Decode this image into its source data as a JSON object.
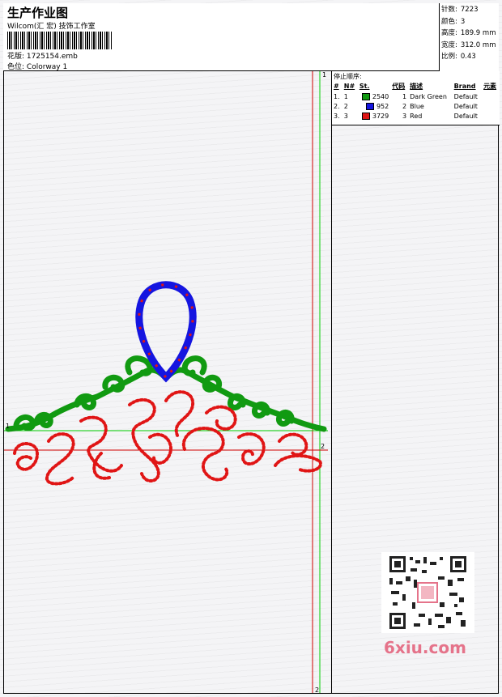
{
  "header": {
    "title": "生产作业图",
    "company": "Wilcom(汇 宏) 技饰工作室",
    "design_label": "花版:",
    "design_value": "1725154.emb",
    "colorway_label": "色位:",
    "colorway_value": "Colorway 1"
  },
  "stats": [
    {
      "label": "针数:",
      "value": "7223"
    },
    {
      "label": "颜色:",
      "value": "3"
    },
    {
      "label": "高度:",
      "value": "189.9 mm"
    },
    {
      "label": "宽度:",
      "value": "312.0 mm"
    },
    {
      "label": "比例:",
      "value": "0.43"
    }
  ],
  "sequence": {
    "title": "停止顺序:",
    "headers": [
      "#",
      "N#",
      "St.",
      "代码",
      "描述",
      "Brand",
      "元素"
    ],
    "rows": [
      {
        "idx": "1.",
        "n": "1",
        "color": "#119a11",
        "stitches": "2540",
        "code": "1",
        "desc": "Dark Green",
        "brand": "Default"
      },
      {
        "idx": "2.",
        "n": "2",
        "color": "#1515e0",
        "stitches": "952",
        "code": "2",
        "desc": "Blue",
        "brand": "Default"
      },
      {
        "idx": "3.",
        "n": "3",
        "color": "#e01515",
        "stitches": "3729",
        "code": "3",
        "desc": "Red",
        "brand": "Default"
      }
    ]
  },
  "guides": {
    "mark_1": "1",
    "mark_2": "2"
  },
  "colors": {
    "green": "#119a11",
    "blue": "#1515e0",
    "red": "#e01515",
    "guide_red": "#d00000",
    "guide_green": "#00cc00"
  },
  "watermark": "6xiu.com"
}
